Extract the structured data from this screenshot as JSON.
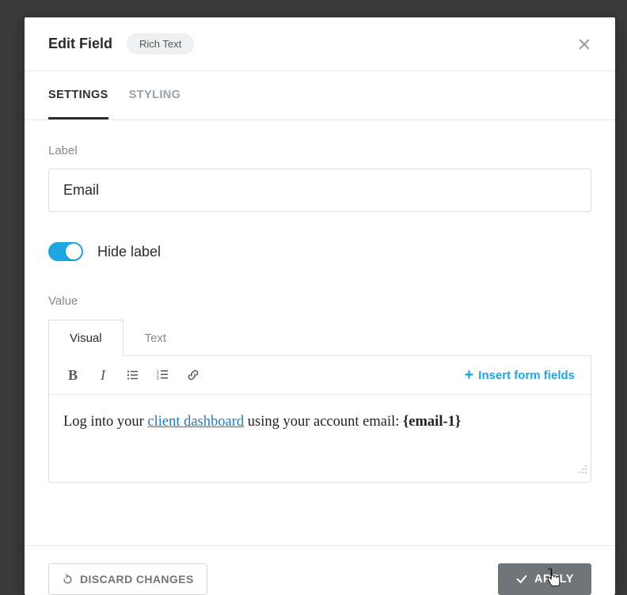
{
  "header": {
    "title": "Edit Field",
    "type_chip": "Rich Text"
  },
  "tabs": {
    "settings": "SETTINGS",
    "styling": "STYLING"
  },
  "settings": {
    "label_title": "Label",
    "label_value": "Email",
    "hide_label": "Hide label",
    "value_title": "Value",
    "editor_tabs": {
      "visual": "Visual",
      "text": "Text"
    },
    "insert_fields": "Insert form fields",
    "content": {
      "pre": "Log into your ",
      "link_text": "client dashboard",
      "mid": " using your account email: ",
      "token": "{email-1}"
    }
  },
  "footer": {
    "discard": "DISCARD CHANGES",
    "apply": "APPLY"
  }
}
